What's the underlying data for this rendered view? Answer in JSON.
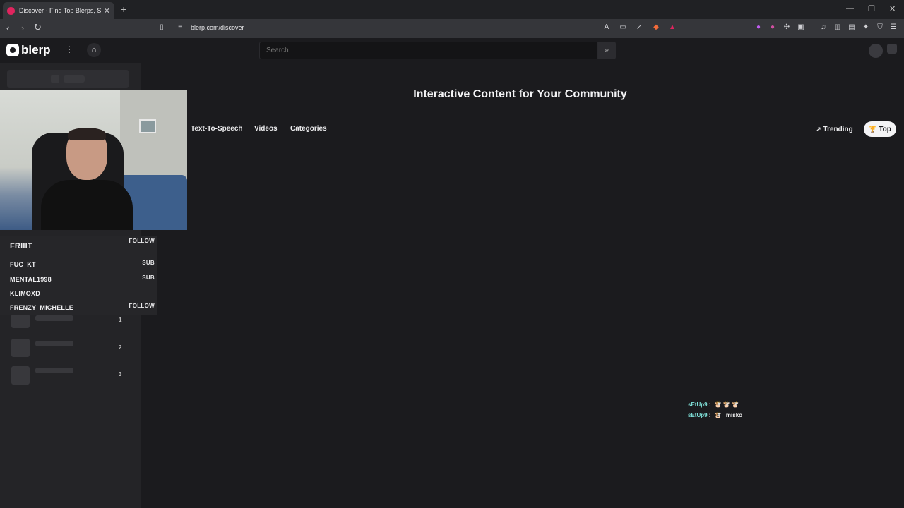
{
  "browser": {
    "tab_title": "Discover - Find Top Blerps, Strea",
    "url": "blerp.com/discover"
  },
  "site": {
    "logo_text": "blerp",
    "search_placeholder": "Search"
  },
  "sidebar": {
    "list": [
      {
        "name": "FRIIIT",
        "tag": "FOLLOW"
      },
      {
        "name": "FUC_KT",
        "tag": "SUB"
      },
      {
        "name": "MENTAL1998",
        "tag": "SUB"
      },
      {
        "name": "KLIMOXD",
        "tag": ""
      },
      {
        "name": "FRENZY_MICHELLE",
        "tag": "FOLLOW"
      }
    ],
    "ranks": [
      "1",
      "2",
      "3"
    ]
  },
  "main": {
    "heading": "Interactive Content for Your Community",
    "filters": [
      "Text-To-Speech",
      "Videos",
      "Categories"
    ],
    "sort": {
      "trending": "Trending",
      "top": "Top"
    }
  },
  "chat": [
    {
      "user": "sEtUp9",
      "sep": ":",
      "emotes": "🐮 🐮 🐮",
      "text": ""
    },
    {
      "user": "sEtUp9",
      "sep": ":",
      "emotes": "🐮",
      "text": "misko"
    }
  ],
  "colors": {
    "background": "#1b1b1e",
    "sidebar": "#242427",
    "chat_user": "#7fe0d8",
    "selected_pill": "#f4f4f6"
  }
}
